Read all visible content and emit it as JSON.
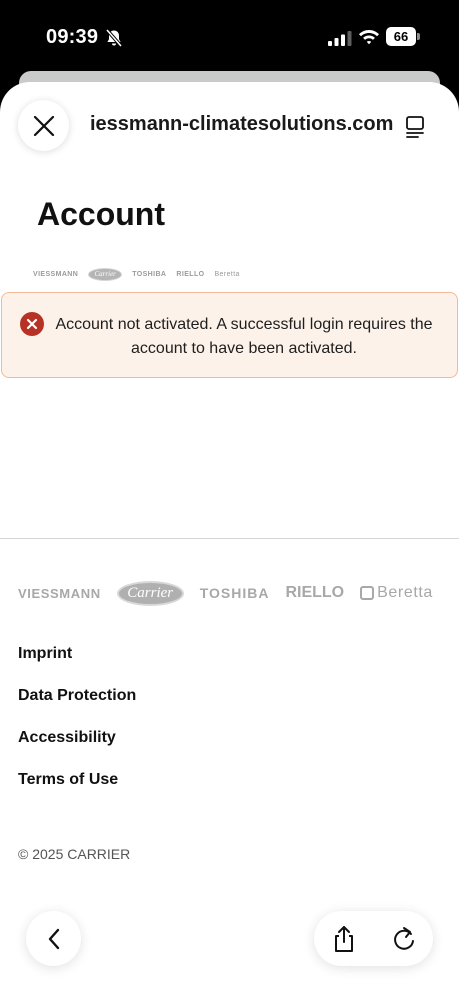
{
  "status_bar": {
    "time": "09:39",
    "battery": "66",
    "icons": [
      "bell-slash-icon",
      "cellular-signal-icon",
      "wifi-icon",
      "battery-icon"
    ]
  },
  "browser": {
    "url": "iessmann-climatesolutions.com",
    "icons": [
      "close-icon",
      "reader-mode-icon",
      "back-icon",
      "share-icon",
      "reload-icon"
    ]
  },
  "page": {
    "title": "Account"
  },
  "brands": {
    "viessmann": "VIESSMANN",
    "carrier": "Carrier",
    "toshiba": "TOSHIBA",
    "riello": "RIELLO",
    "beretta": "Beretta"
  },
  "alert": {
    "message": "Account not activated. A successful login requires the account to have been activated.",
    "icon": "error-x-icon",
    "color": "#b53225"
  },
  "footer": {
    "links": [
      "Imprint",
      "Data Protection",
      "Accessibility",
      "Terms of Use"
    ],
    "copyright": "© 2025 CARRIER"
  }
}
